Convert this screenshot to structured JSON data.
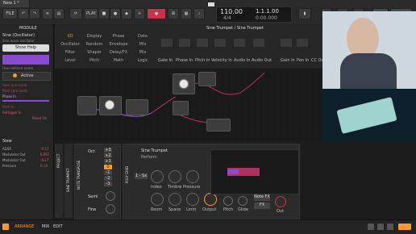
{
  "toolbar": {
    "file": "FILE",
    "tab": "New 1 *",
    "play": "PLAY",
    "tempo": "110.00",
    "timesig": "4/4",
    "position": "1.1.1.00",
    "time": "0:00.000",
    "edit": "EDIT",
    "module": "MODULE"
  },
  "left": {
    "header": "MODULE",
    "device_name": "Sine (Oscillator)",
    "device_desc": "Sine wave oscillator",
    "show_help": "Show Help",
    "user_name": "User-defined name",
    "active": "Active",
    "ports": [
      "Gain (pre-cord)",
      "Pitch (pre-cord)",
      "Phase In",
      "Pitch In",
      "Retrigger In",
      "Reset On"
    ],
    "section": "Slew",
    "mods": [
      {
        "name": "ADSR",
        "value": "-0.17"
      },
      {
        "name": "Modulator Out",
        "value": "0.097"
      },
      {
        "name": "Modulator Out",
        "value": "-0.17"
      },
      {
        "name": "Pressure",
        "value": "0.13"
      }
    ]
  },
  "browser": {
    "title": "Sine Trumpet / Sine Trumpet",
    "categories": [
      [
        "I/O",
        "Display",
        "Phase",
        "Data"
      ],
      [
        "Oscillator",
        "Random",
        "Envelope",
        "Mix"
      ],
      [
        "Filter",
        "Shaper",
        "Delay/FX",
        "Mix"
      ],
      [
        "Level",
        "Pitch",
        "Math",
        "Logic"
      ]
    ],
    "io": [
      "Gate In",
      "Phase In",
      "Pitch In",
      "Velocity In",
      "Audio In",
      "Audio Out",
      "Gain In",
      "Pan In",
      "CC Out"
    ]
  },
  "chain": {
    "project": "PROJECT",
    "track": "SINE TRUMPET",
    "transpose": "NOTE TRANSPOSE",
    "oct": "Oct",
    "octs": [
      "+3",
      "+2",
      "+1",
      "0",
      "-1",
      "-2",
      "-3"
    ],
    "semi": "Semi",
    "fine": "Fine",
    "polygrid": "POLY GRID",
    "preset": "Sine Trumpet",
    "perform": "Perform",
    "voices": "1 - Sx",
    "knobs": [
      "Index",
      "Timbre",
      "Pressure",
      "Room",
      "Space",
      "Limit",
      "Output"
    ],
    "pitch": "Pitch",
    "glide": "Glide",
    "notefx": "Note FX",
    "fx": "FX",
    "out": "Out"
  },
  "status": {
    "arrange": "ARRANGE",
    "mix": "MIX",
    "edit": "EDIT"
  },
  "colors": {
    "accent": "#ff9a1f",
    "red": "#c8324a",
    "purple": "#8a4bd0",
    "cable": "#b03060"
  }
}
